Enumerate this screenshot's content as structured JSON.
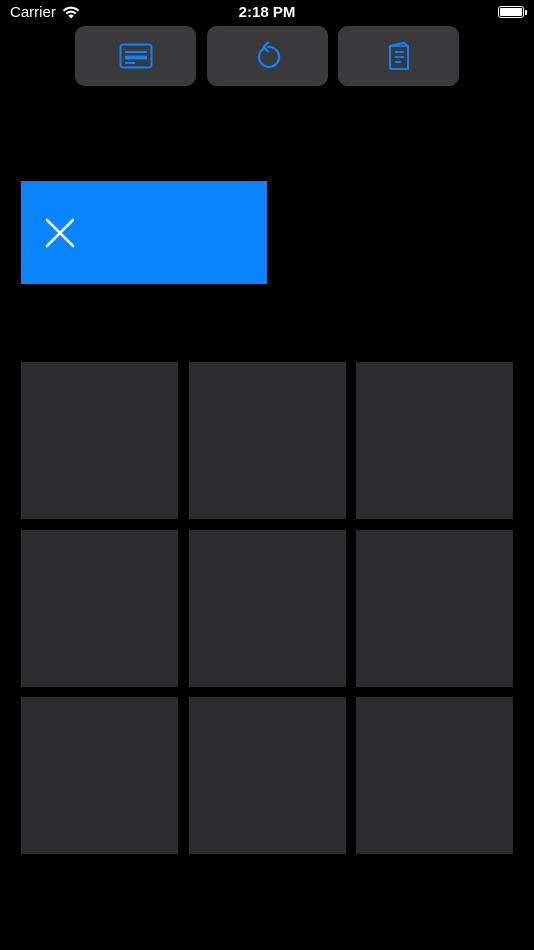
{
  "status_bar": {
    "carrier": "Carrier",
    "time": "2:18 PM",
    "battery_level": 1.0
  },
  "toolbar": {
    "buttons": [
      {
        "icon": "scoreboard-icon"
      },
      {
        "icon": "restart-icon"
      },
      {
        "icon": "rules-book-icon"
      }
    ]
  },
  "turn_indicator": {
    "icon": "x-mark-icon",
    "color": "#0a84ff"
  },
  "board": {
    "cells": [
      "",
      "",
      "",
      "",
      "",
      "",
      "",
      "",
      ""
    ],
    "cell_color": "#2c2c2e"
  },
  "colors": {
    "accent": "#0a84ff",
    "background": "#000000",
    "button_bg": "#3a3a3c"
  }
}
